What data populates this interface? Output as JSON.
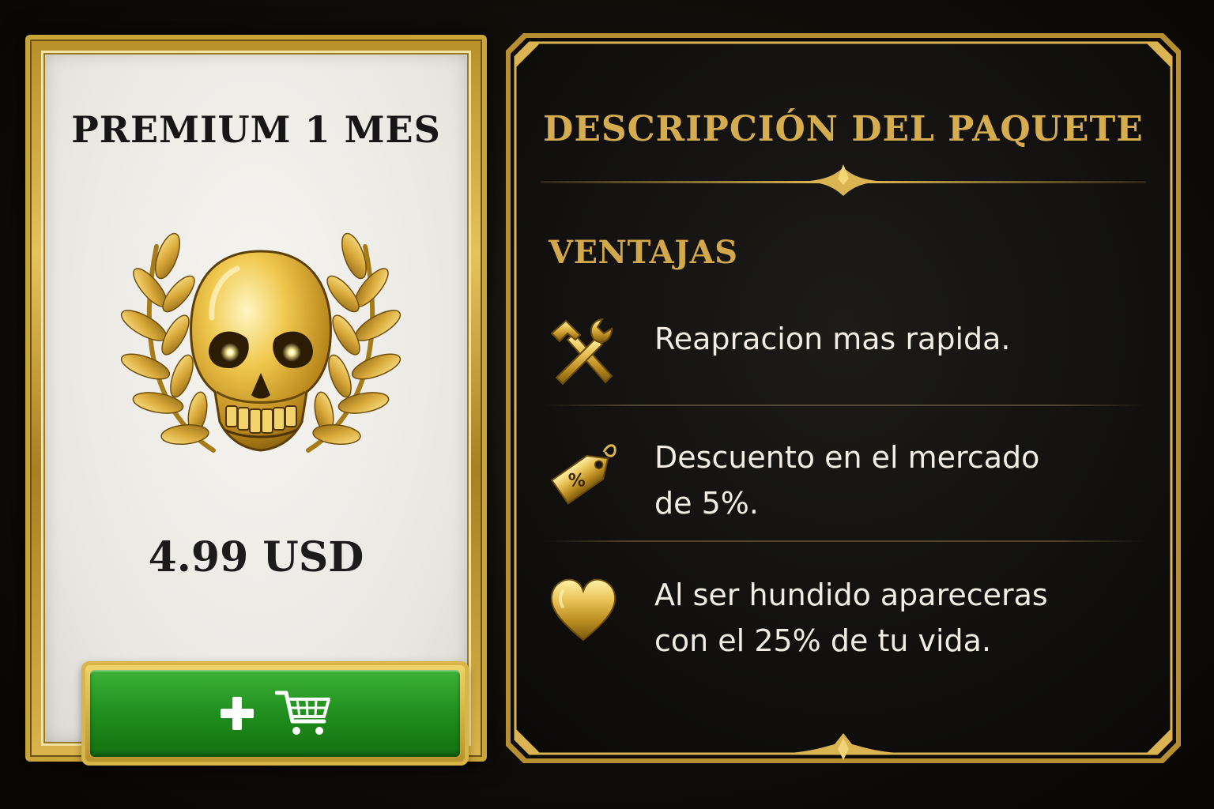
{
  "product": {
    "title": "PREMIUM 1 MES",
    "emblem_icon": "golden-skull-laurel-icon",
    "price": "4.99 USD",
    "buy_button": {
      "icons": [
        "plus-icon",
        "shopping-cart-icon"
      ],
      "color": "#21921f"
    }
  },
  "description": {
    "title": "DESCRIPCIÓN DEL PAQUETE",
    "section_title": "VENTAJAS",
    "benefits": [
      {
        "icon": "hammer-wrench-icon",
        "text": "Reapracion mas rapida."
      },
      {
        "icon": "discount-tag-icon",
        "text": "Descuento en el mercado\nde 5%."
      },
      {
        "icon": "heart-icon",
        "text": "Al ser hundido apareceras\ncon el 25% de tu vida."
      }
    ]
  },
  "colors": {
    "gold": "#d6ad4e",
    "panel_background": "#121110",
    "card_background": "#ecebe6",
    "button_green": "#21921f"
  }
}
